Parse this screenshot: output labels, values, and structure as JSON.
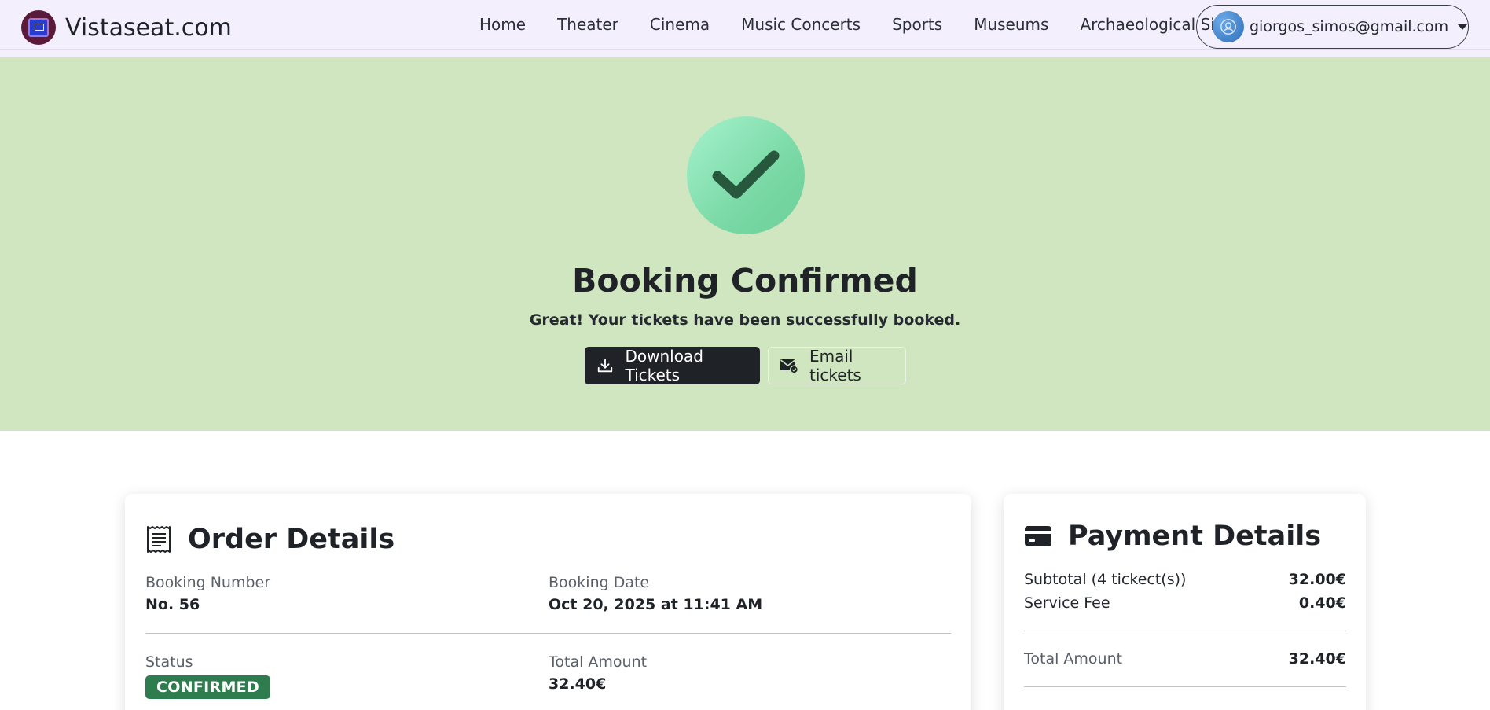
{
  "brand": {
    "name": "Vistaseat.com"
  },
  "nav": {
    "links": [
      "Home",
      "Theater",
      "Cinema",
      "Music Concerts",
      "Sports",
      "Museums",
      "Archaeological Sites"
    ],
    "user_email": "giorgos_simos@gmail.com"
  },
  "hero": {
    "title": "Booking Confirmed",
    "subtitle": "Great! Your tickets have been successfully booked.",
    "download_label": "Download Tickets",
    "email_label": "Email tickets"
  },
  "order": {
    "title": "Order Details",
    "booking_number_label": "Booking Number",
    "booking_number": "No. 56",
    "booking_date_label": "Booking Date",
    "booking_date": "Oct 20, 2025 at 11:41 AM",
    "status_label": "Status",
    "status": "CONFIRMED",
    "total_label": "Total Amount",
    "total": "32.40€"
  },
  "payment": {
    "title": "Payment Details",
    "subtotal_label": "Subtotal (4 tickect(s))",
    "subtotal": "32.00€",
    "fee_label": "Service Fee",
    "fee": "0.40€",
    "total_label": "Total Amount",
    "total": "32.40€"
  },
  "colors": {
    "hero_bg": "#cfe6c0",
    "navbar_bg": "#f3effc",
    "status_badge": "#2f7d4f",
    "primary_button": "#1f2328"
  }
}
